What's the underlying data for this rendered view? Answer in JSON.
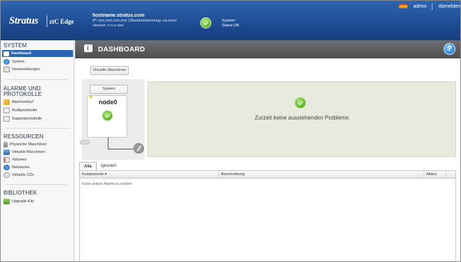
{
  "header": {
    "logo_brand": "Stratus",
    "logo_product": "ztC Edge",
    "hostname": "hostname.stratus.com",
    "ip_line": "IP: nnn.nnn.nnn.nnn | Bestandskennung: za-nnnn",
    "version_line": "Version: n.n.n-nnn",
    "system_label": "System:",
    "system_status": "Status OK",
    "user": "admin",
    "logout": "Abmelden"
  },
  "sidebar": {
    "system_title": "SYSTEM",
    "system_items": [
      "Dashboard",
      "System",
      "Voreinstellungen"
    ],
    "alarms_title_1": "ALARME UND",
    "alarms_title_2": "PROTOKOLLE",
    "alarms_items": [
      "Alarmverlauf",
      "Auditprotokolle",
      "Supportprotokolle"
    ],
    "resources_title": "RESSOURCEN",
    "resources_items": [
      "Physische Maschinen",
      "Virtuelle Maschinen",
      "Volumes",
      "Netzwerke",
      "Virtuelle CDs"
    ],
    "library_title": "BIBLIOTHEK",
    "library_items": [
      "Upgrade-Kits"
    ]
  },
  "dashboard": {
    "title": "DASHBOARD",
    "help": "?",
    "vm_button": "Virtuelle Maschinen",
    "system_button": "System",
    "node_name": "node0",
    "no_problems": "Zurzeit keine ausstehenden Probleme."
  },
  "alarms": {
    "tabs": [
      "Alle",
      "Ignoriert"
    ],
    "columns": [
      "Komponente ▾",
      "Beschreibung",
      "Aktion"
    ],
    "empty_text": "Keine aktiven Alarme zu melden"
  }
}
